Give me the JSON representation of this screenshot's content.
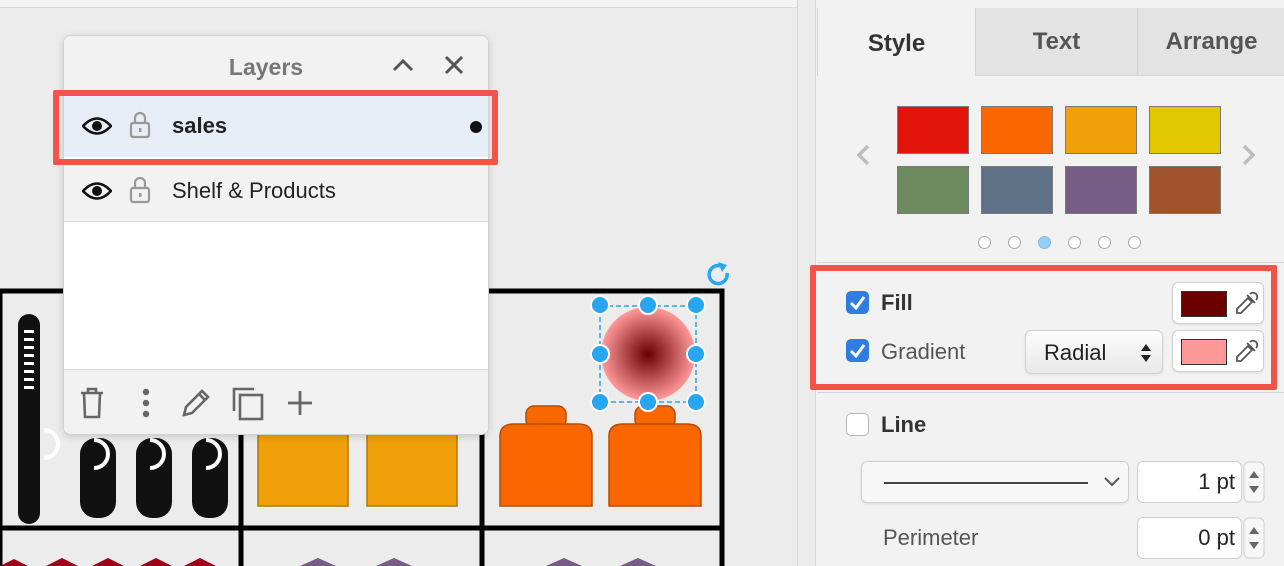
{
  "layers_panel": {
    "title": "Layers",
    "layers": [
      {
        "label": "sales",
        "selected": true
      },
      {
        "label": "Shelf & Products",
        "selected": false
      }
    ]
  },
  "format_panel": {
    "tabs": [
      "Style",
      "Text",
      "Arrange"
    ],
    "active_tab": "Style",
    "swatches": [
      "#e2140a",
      "#fa6700",
      "#f0a10a",
      "#e2c800",
      "#6d8b5f",
      "#5e7186",
      "#775d86",
      "#a0522d"
    ],
    "swatch_page_active": 3,
    "swatch_page_count": 6,
    "fill": {
      "label": "Fill",
      "checked": true,
      "color": "#6b0000"
    },
    "gradient": {
      "label": "Gradient",
      "checked": true,
      "direction": "Radial",
      "color": "#ff9999"
    },
    "line": {
      "label": "Line",
      "checked": false,
      "width": "1 pt"
    },
    "perimeter": {
      "label": "Perimeter",
      "value": "0 pt"
    }
  },
  "colors": {
    "highlight": "#f4534a",
    "selection_handle": "#29a6f0",
    "checkbox": "#2f7de1"
  },
  "icons": [
    "eye-icon",
    "lock-icon",
    "chevron-up-icon",
    "close-icon",
    "trash-icon",
    "more-vertical-icon",
    "edit-icon",
    "duplicate-icon",
    "add-icon",
    "rotate-icon",
    "eyedropper-icon",
    "chevron-left-icon",
    "chevron-right-icon",
    "chevron-down-icon"
  ]
}
